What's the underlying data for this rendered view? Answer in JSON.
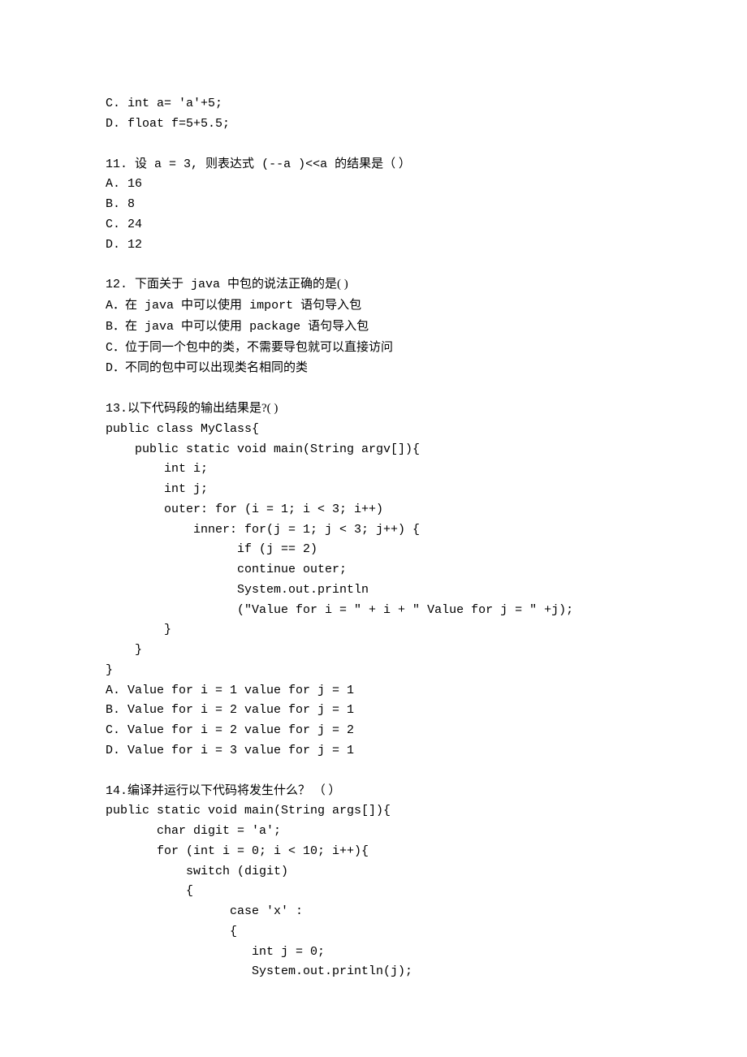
{
  "block0": {
    "l0": "C. int a= 'a'+5;",
    "l1": "D. float f=5+5.5;"
  },
  "q11": {
    "prompt_pre": "11. ",
    "prompt_cjk1": "设",
    "prompt_mid1": " a = 3, ",
    "prompt_cjk2": "则表达式",
    "prompt_mid2": " (--a )<<a ",
    "prompt_cjk3": "的结果是（ ）",
    "a": "A. 16",
    "b": "B. 8",
    "c": "C. 24",
    "d": "D. 12"
  },
  "q12": {
    "prompt_pre": "12. ",
    "prompt_cjk1": "下面关于",
    "prompt_mid1": " java ",
    "prompt_cjk2": "中包的说法正确的是( )",
    "a_pre": "A．",
    "a_cjk1": "在",
    "a_mid1": " java ",
    "a_cjk2": "中可以使用",
    "a_mid2": " import ",
    "a_cjk3": "语句导入包",
    "b_pre": "B．",
    "b_cjk1": "在",
    "b_mid1": " java ",
    "b_cjk2": "中可以使用",
    "b_mid2": " package ",
    "b_cjk3": "语句导入包",
    "c_pre": "C．",
    "c_txt": "位于同一个包中的类，不需要导包就可以直接访问",
    "d_pre": "D．",
    "d_txt": "不同的包中可以出现类名相同的类"
  },
  "q13": {
    "prompt_pre": "13.",
    "prompt_cjk": "以下代码段的输出结果是?( )",
    "c0": "public class MyClass{",
    "c1": "    public static void main(String argv[]){",
    "c2": "        int i;",
    "c3": "        int j;",
    "c4": "        outer: for (i = 1; i < 3; i++)",
    "c5": "            inner: for(j = 1; j < 3; j++) {",
    "c6": "                  if (j == 2)",
    "c7": "                  continue outer;",
    "c8": "                  System.out.println",
    "c9": "                  (\"Value for i = \" + i + \" Value for j = \" +j);",
    "c10": "        }",
    "c11": "    }",
    "c12": "}",
    "a": "A. Value for i = 1 value for j = 1",
    "b": "B. Value for i = 2 value for j = 1",
    "c": "C. Value for i = 2 value for j = 2",
    "d": "D. Value for i = 3 value for j = 1"
  },
  "q14": {
    "prompt_pre": "14.",
    "prompt_cjk": "编译并运行以下代码将发生什么？ （ ）",
    "c0": "public static void main(String args[]){",
    "c1": "       char digit = 'a';",
    "c2": "       for (int i = 0; i < 10; i++){",
    "c3": "           switch (digit)",
    "c4": "           {",
    "c5": "                 case 'x' :",
    "c6": "                 {",
    "c7": "                    int j = 0;",
    "c8": "                    System.out.println(j);"
  }
}
